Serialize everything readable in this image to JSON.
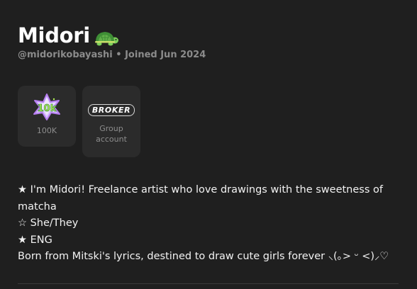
{
  "profile": {
    "display_name": "Midori",
    "name_emoji": "turtle-emoji",
    "handle": "@midorikobayashi",
    "separator": "•",
    "joined": "Joined Jun 2024"
  },
  "badges": [
    {
      "icon": "100k-star-badge-icon",
      "label": "100K"
    },
    {
      "icon_text": "BROKER",
      "label": "Group account"
    }
  ],
  "bio": {
    "lines": [
      "★ I'm Midori! Freelance artist who love drawings with the sweetness of matcha",
      "☆ She/They",
      "★ ENG",
      "Born from Mitski's lyrics, destined to draw cute girls forever ⸜(｡> ᵕ <)⸝♡"
    ]
  },
  "colors": {
    "background": "#1f1f1f",
    "card": "#2b2b2b",
    "muted_text": "#8b8b8b",
    "badge_purple": "#b67ef0",
    "badge_green": "#b6f25a"
  }
}
